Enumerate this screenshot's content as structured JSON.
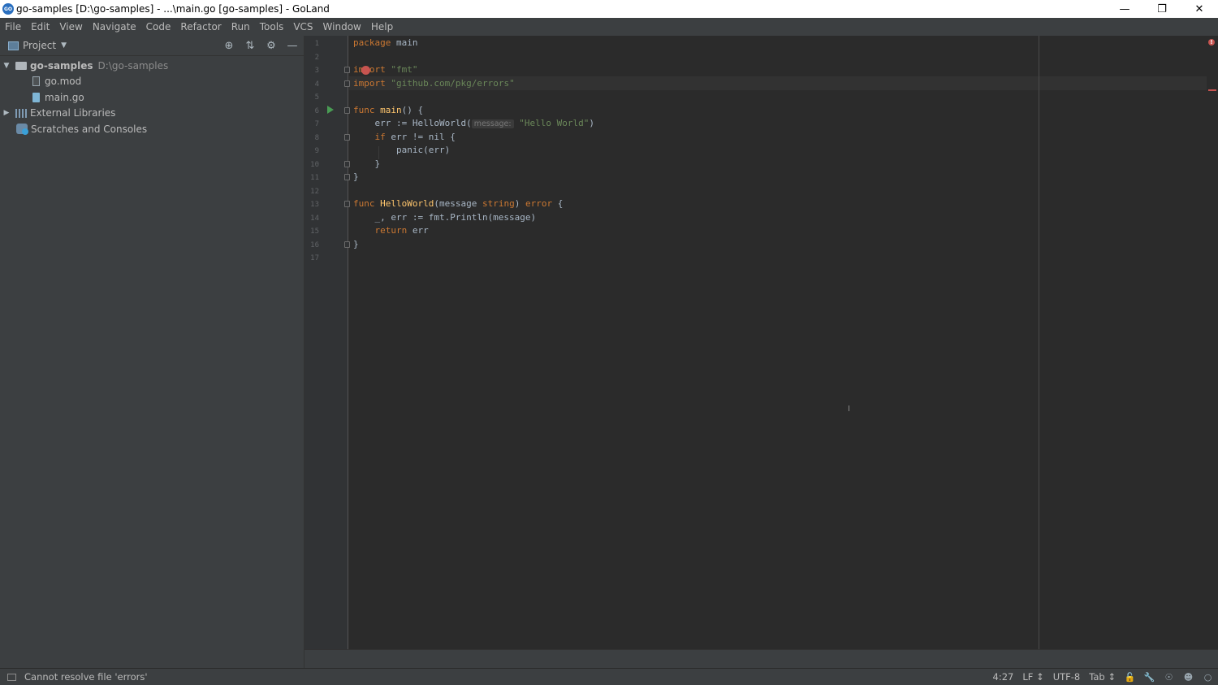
{
  "window": {
    "title": "go-samples [D:\\go-samples] - ...\\main.go [go-samples] - GoLand",
    "app_icon": "goland-icon",
    "controls": [
      "minimize-icon",
      "restore-icon",
      "close-icon"
    ]
  },
  "menu": [
    "File",
    "Edit",
    "View",
    "Navigate",
    "Code",
    "Refactor",
    "Run",
    "Tools",
    "VCS",
    "Window",
    "Help"
  ],
  "project_panel": {
    "title": "Project",
    "tools": [
      "locate-icon",
      "collapse-all-icon",
      "settings-gear-icon",
      "minimize-panel-icon"
    ],
    "root": {
      "name": "go-samples",
      "path": "D:\\go-samples"
    },
    "files": [
      "go.mod",
      "main.go"
    ],
    "external_libraries": "External Libraries",
    "scratches": "Scratches and Consoles"
  },
  "editor": {
    "line_numbers": [
      "1",
      "2",
      "3",
      "4",
      "5",
      "6",
      "7",
      "8",
      "9",
      "10",
      "11",
      "12",
      "13",
      "14",
      "15",
      "16",
      "17"
    ],
    "lines": {
      "l1_kw": "package",
      "l1_rest": " main",
      "l3_kw": "import",
      "l3_str": " \"fmt\"",
      "l4_kw": "import",
      "l4_str": " \"github.com/pkg/errors\"",
      "l6_kw": "func",
      "l6_fn": " main",
      "l6_rest": "() {",
      "l7_a": "    err := HelloWorld(",
      "l7_hint": "message:",
      "l7_str": " \"Hello World\"",
      "l7_b": ")",
      "l8_kw": "    if",
      "l8_rest": " err != nil {",
      "l9": "        panic(err)",
      "l10": "    }",
      "l11": "}",
      "l13_kw": "func",
      "l13_fn": " HelloWorld",
      "l13_a": "(message ",
      "l13_typ": "string",
      "l13_b": ") ",
      "l13_typ2": "error",
      "l13_c": " {",
      "l14": "    _, err := fmt.Println(message)",
      "l15_kw": "    return",
      "l15_rest": " err",
      "l16": "}"
    }
  },
  "colors": {
    "keyword": "#cc7832",
    "string": "#6a8759",
    "function": "#ffc66d",
    "error": "#c75450",
    "run": "#499c54"
  },
  "status": {
    "message": "Cannot resolve file 'errors'",
    "position": "4:27",
    "line_sep": "LF ↕",
    "encoding": "UTF-8",
    "indent": "Tab ↕",
    "icons": [
      "lock-icon",
      "wrench-icon",
      "inspect-icon",
      "hector-icon",
      "event-log-icon"
    ]
  }
}
